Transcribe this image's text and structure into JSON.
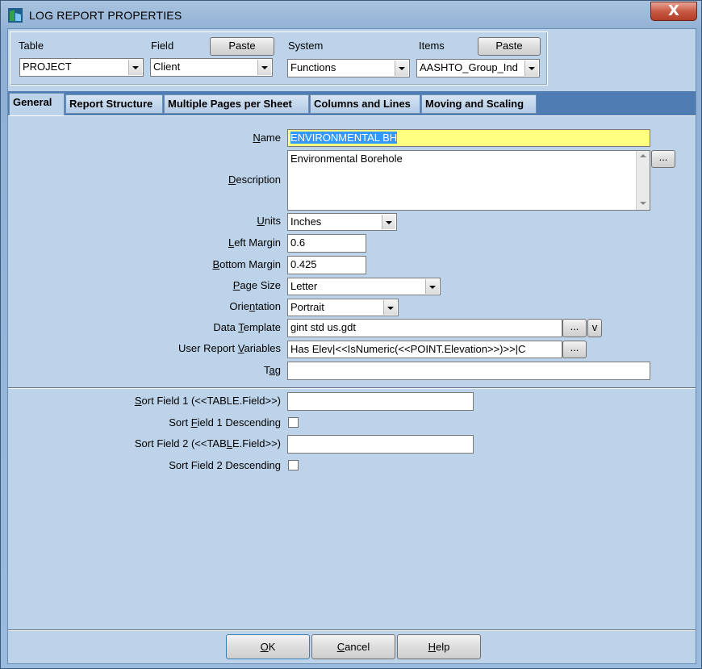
{
  "window": {
    "title": "LOG REPORT PROPERTIES",
    "close_glyph": "X"
  },
  "top": {
    "table_label": "Table",
    "table_value": "PROJECT",
    "field_label": "Field",
    "field_value": "Client",
    "field_paste": "Paste",
    "system_label": "System",
    "system_value": "Functions",
    "items_label": "Items",
    "items_value": "AASHTO_Group_Ind",
    "items_paste": "Paste"
  },
  "tabs": [
    {
      "label": "General"
    },
    {
      "label": "Report Structure"
    },
    {
      "label": "Multiple Pages per Sheet"
    },
    {
      "label": "Columns and Lines"
    },
    {
      "label": "Moving and Scaling"
    }
  ],
  "form": {
    "name_label": [
      "",
      "N",
      "ame"
    ],
    "name_value": "ENVIRONMENTAL BH",
    "description_label": [
      "",
      "D",
      "escription"
    ],
    "description_value": "Environmental Borehole",
    "description_btn": "...",
    "units_label": [
      "",
      "U",
      "nits"
    ],
    "units_value": "Inches",
    "left_margin_label": [
      "",
      "L",
      "eft Margin"
    ],
    "left_margin_value": "0.6",
    "bottom_margin_label": [
      "",
      "B",
      "ottom Margin"
    ],
    "bottom_margin_value": "0.425",
    "page_size_label": [
      "",
      "P",
      "age Size"
    ],
    "page_size_value": "Letter",
    "orientation_label": [
      "Orie",
      "n",
      "tation"
    ],
    "orientation_value": "Portrait",
    "data_template_label": [
      "Data ",
      "T",
      "emplate"
    ],
    "data_template_value": "gint std us.gdt",
    "data_template_btn": "...",
    "data_template_btn2": "v",
    "user_vars_label": [
      "User Report ",
      "V",
      "ariables"
    ],
    "user_vars_value": "Has Elev|<<IsNumeric(<<POINT.Elevation>>)>>|C",
    "user_vars_btn": "...",
    "tag_label": [
      "T",
      "a",
      "g"
    ],
    "tag_value": "",
    "sort1_label": [
      "",
      "S",
      "ort Field 1 (<<TABLE.Field>>)"
    ],
    "sort1_value": "",
    "sort1_desc_label": [
      "Sort ",
      "F",
      "ield 1 Descending"
    ],
    "sort2_label": [
      "Sort Field 2 (<<TAB",
      "L",
      "E.Field>>)"
    ],
    "sort2_value": "",
    "sort2_desc_label": [
      "Sort Field 2 Descending",
      "",
      ""
    ]
  },
  "buttons": {
    "ok": [
      "",
      "O",
      "K"
    ],
    "cancel": [
      "",
      "C",
      "ancel"
    ],
    "help": [
      "",
      "H",
      "elp"
    ]
  },
  "colors": {
    "name_highlight": "#ffff80",
    "selection": "#3399ff",
    "tab_strip": "#4f7db3"
  }
}
